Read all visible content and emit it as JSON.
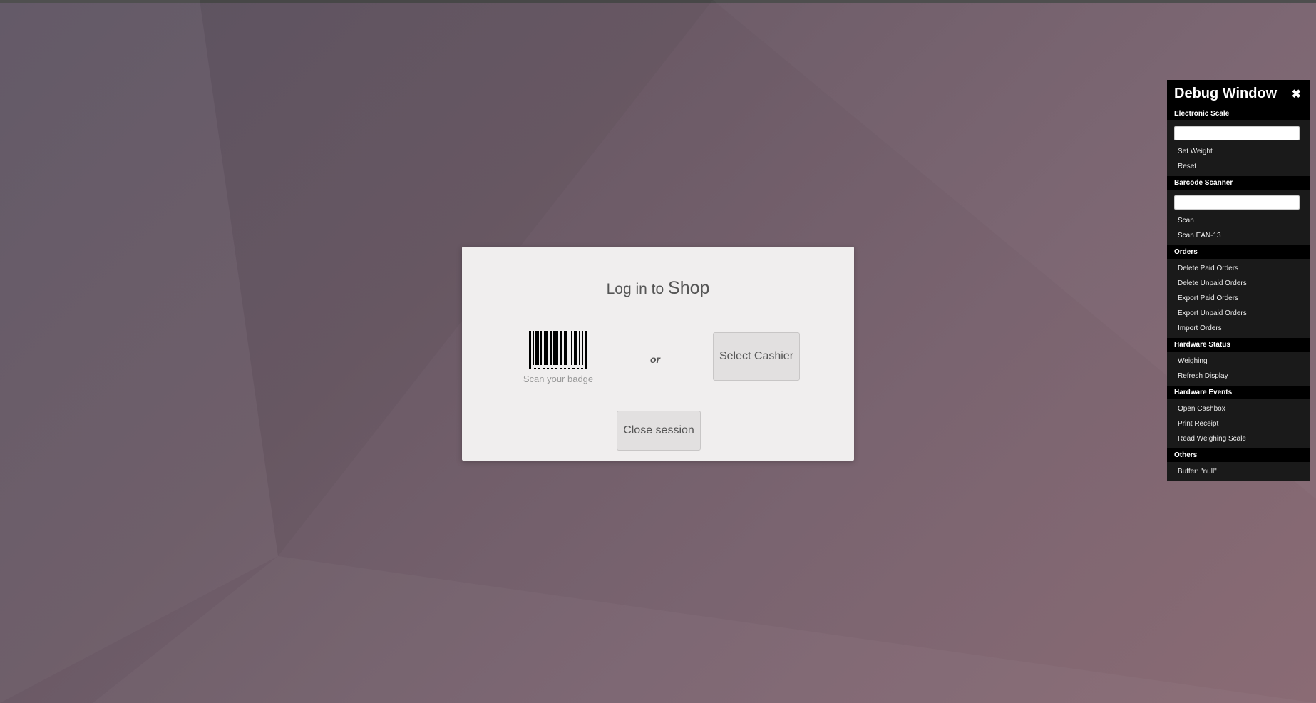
{
  "login": {
    "title_prefix": "Log in to",
    "title_shop": "Shop",
    "badge_label": "Scan your badge",
    "or_label": "or",
    "select_cashier_label": "Select Cashier",
    "close_session_label": "Close session"
  },
  "debug": {
    "title": "Debug Window",
    "close_glyph": "✖",
    "electronic_scale": {
      "title": "Electronic Scale",
      "input_value": "",
      "buttons": [
        "Set Weight",
        "Reset"
      ]
    },
    "barcode_scanner": {
      "title": "Barcode Scanner",
      "input_value": "",
      "buttons": [
        "Scan",
        "Scan EAN-13"
      ]
    },
    "orders": {
      "title": "Orders",
      "buttons": [
        "Delete Paid Orders",
        "Delete Unpaid Orders",
        "Export Paid Orders",
        "Export Unpaid Orders",
        "Import Orders"
      ]
    },
    "hardware_status": {
      "title": "Hardware Status",
      "buttons": [
        "Weighing",
        "Refresh Display"
      ]
    },
    "hardware_events": {
      "title": "Hardware Events",
      "buttons": [
        "Open Cashbox",
        "Print Receipt",
        "Read Weighing Scale"
      ]
    },
    "others": {
      "title": "Others",
      "buffer_text": "Buffer: \"null\""
    }
  },
  "colors": {
    "background": "#6b5a66",
    "dialog": "#f0eeee",
    "debug_bg": "#000000"
  }
}
